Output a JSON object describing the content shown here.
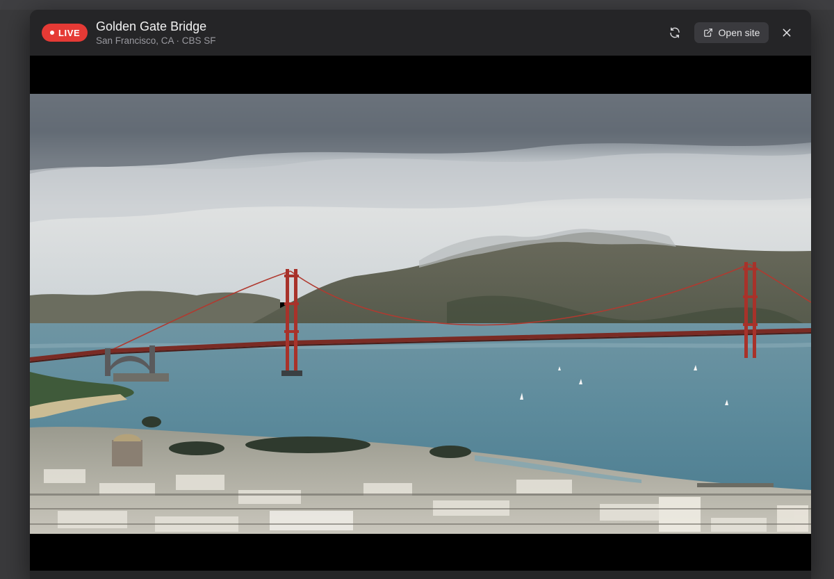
{
  "stream": {
    "badge_label": "LIVE",
    "title": "Golden Gate Bridge",
    "subtitle": "San Francisco, CA · CBS SF"
  },
  "actions": {
    "refresh_icon": "refresh-icon",
    "open_label": "Open site",
    "open_icon": "external-link-icon",
    "close_icon": "close-icon"
  },
  "colors": {
    "live_badge": "#e53a35",
    "modal_bg": "#252527",
    "button_bg": "#3a3a3e",
    "bridge": "#a8322a"
  }
}
